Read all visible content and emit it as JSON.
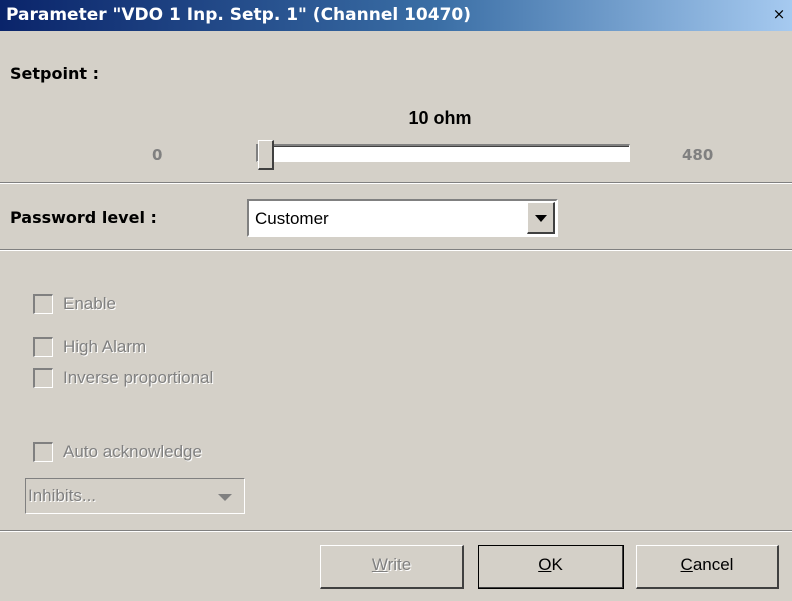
{
  "window": {
    "title": "Parameter \"VDO 1 Inp. Setp. 1\" (Channel 10470)",
    "close_glyph": "×"
  },
  "setpoint": {
    "label": "Setpoint :",
    "value_text": "10 ohm",
    "min": "0",
    "max": "480",
    "value": 10
  },
  "password": {
    "label": "Password level :",
    "selected": "Customer"
  },
  "options": {
    "enable": {
      "label": "Enable",
      "checked": false
    },
    "high_alarm": {
      "label": "High Alarm",
      "checked": false
    },
    "inverse_proportional": {
      "label": "Inverse proportional",
      "checked": false
    },
    "auto_acknowledge": {
      "label": "Auto acknowledge",
      "checked": false
    }
  },
  "inhibits": {
    "label": "Inhibits..."
  },
  "buttons": {
    "write": {
      "mnemonic": "W",
      "rest": "rite"
    },
    "ok": {
      "mnemonic": "O",
      "rest": "K"
    },
    "cancel": {
      "mnemonic": "C",
      "rest": "ancel"
    }
  }
}
